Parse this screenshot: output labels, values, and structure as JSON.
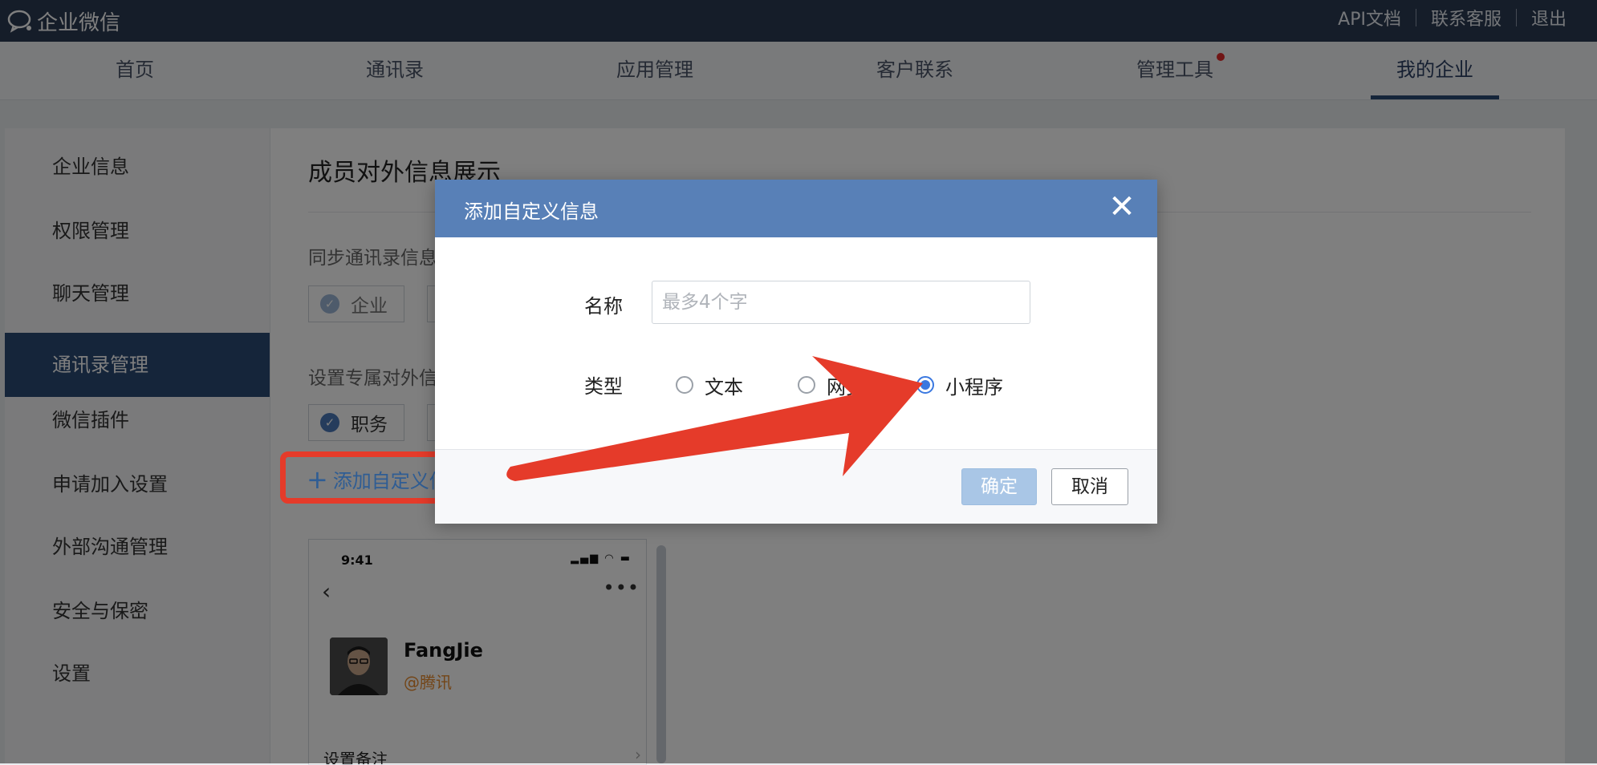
{
  "header": {
    "logo_text": "企业微信",
    "links": [
      "API文档",
      "联系客服",
      "退出"
    ]
  },
  "nav": {
    "items": [
      "首页",
      "通讯录",
      "应用管理",
      "客户联系",
      "管理工具",
      "我的企业"
    ],
    "active": "我的企业",
    "notification_dot_on": "管理工具"
  },
  "sidebar": {
    "items": [
      "企业信息",
      "权限管理",
      "聊天管理",
      "通讯录管理",
      "微信插件",
      "申请加入设置",
      "外部沟通管理",
      "安全与保密",
      "设置"
    ],
    "active": "通讯录管理"
  },
  "main": {
    "title": "成员对外信息展示",
    "sync_label": "同步通讯录信息",
    "sync_chip": "企业",
    "custom_label": "设置专属对外信",
    "custom_chip": "职务",
    "add_custom": "添加自定义信"
  },
  "phone_preview": {
    "time": "9:41",
    "name": "FangJie",
    "corp": "@腾讯",
    "row_label": "设置备注"
  },
  "dialog": {
    "title": "添加自定义信息",
    "name_label": "名称",
    "name_placeholder": "最多4个字",
    "name_value": "",
    "type_label": "类型",
    "type_options": [
      "文本",
      "网页",
      "小程序"
    ],
    "type_selected": "小程序",
    "ok_label": "确定",
    "cancel_label": "取消"
  },
  "colors": {
    "header_bg": "#2b3a52",
    "nav_active": "#2b4a75",
    "dialog_header": "#5880b7",
    "radio_checked": "#3a78e0",
    "annotation_red": "#e53b2a",
    "ok_button": "#a9c6e6"
  }
}
